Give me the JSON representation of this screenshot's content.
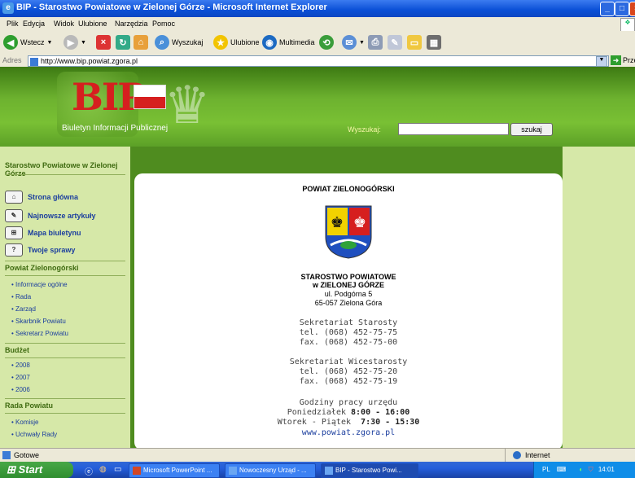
{
  "window": {
    "title": "BIP - Starostwo Powiatowe w Zielonej Górze - Microsoft Internet Explorer"
  },
  "menu": [
    "Plik",
    "Edycja",
    "Widok",
    "Ulubione",
    "Narzędzia",
    "Pomoc"
  ],
  "toolbar": {
    "back": "Wstecz",
    "search": "Wyszukaj",
    "favorites": "Ulubione",
    "multimedia": "Multimedia"
  },
  "address": {
    "label": "Adres",
    "url": "http://www.bip.powiat.zgora.pl",
    "go": "Przejdź"
  },
  "banner": {
    "logo": "BIP",
    "subtitle": "Biuletyn Informacji Publicznej",
    "search_label": "Wyszukaj:",
    "search_value": "",
    "search_button": "szukaj"
  },
  "sidebar": {
    "site_name": "Starostwo Powiatowe w Zielonej Górze",
    "nav": [
      {
        "label": "Strona główna",
        "icon": "home-icon"
      },
      {
        "label": "Najnowsze artykuły",
        "icon": "pencil-icon"
      },
      {
        "label": "Mapa biuletynu",
        "icon": "sitemap-icon"
      },
      {
        "label": "Twoje sprawy",
        "icon": "help-icon"
      }
    ],
    "sections": [
      {
        "title": "Powiat Zielonogórski",
        "links": [
          "Informacje ogólne",
          "Rada",
          "Zarząd",
          "Skarbnik Powiatu",
          "Sekretarz Powiatu"
        ]
      },
      {
        "title": "Budżet",
        "links": [
          "2008",
          "2007",
          "2006"
        ]
      },
      {
        "title": "Rada Powiatu",
        "links": [
          "Komisje",
          "Uchwały Rady"
        ]
      }
    ]
  },
  "content": {
    "heading": "POWIAT ZIELONOGÓRSKI",
    "office_line1": "STAROSTWO POWIATOWE",
    "office_line2": "w ZIELONEJ GÓRZE",
    "street": "ul. Podgórna 5",
    "city": "65-057 Zielona Góra",
    "sek_starosty": "Sekretariat Starosty",
    "sek_starosty_tel": "tel. (068) 452-75-75",
    "sek_starosty_fax": "fax. (068) 452-75-00",
    "sek_wice": "Sekretariat Wicestarosty",
    "sek_wice_tel": "tel. (068) 452-75-20",
    "sek_wice_fax": "fax. (068) 452-75-19",
    "hours_title": "Godziny pracy urzędu",
    "hours_mon_label": "Poniedziałek",
    "hours_mon": "8:00 - 16:00",
    "hours_tf_label": "Wtorek - Piątek",
    "hours_tf": "7:30 - 15:30",
    "website": "www.powiat.zgora.pl"
  },
  "statusbar": {
    "status": "Gotowe",
    "zone": "Internet"
  },
  "taskbar": {
    "start": "Start",
    "tasks": [
      "Microsoft PowerPoint ...",
      "Nowoczesny Urząd - ...",
      "BIP - Starostwo Powi..."
    ],
    "lang": "PL",
    "time": "14:01"
  },
  "colors": {
    "banner_green": "#6db22f",
    "sidebar_bg": "#d6e8a8",
    "link_blue": "#1b3e9e",
    "xp_blue": "#245edb"
  }
}
